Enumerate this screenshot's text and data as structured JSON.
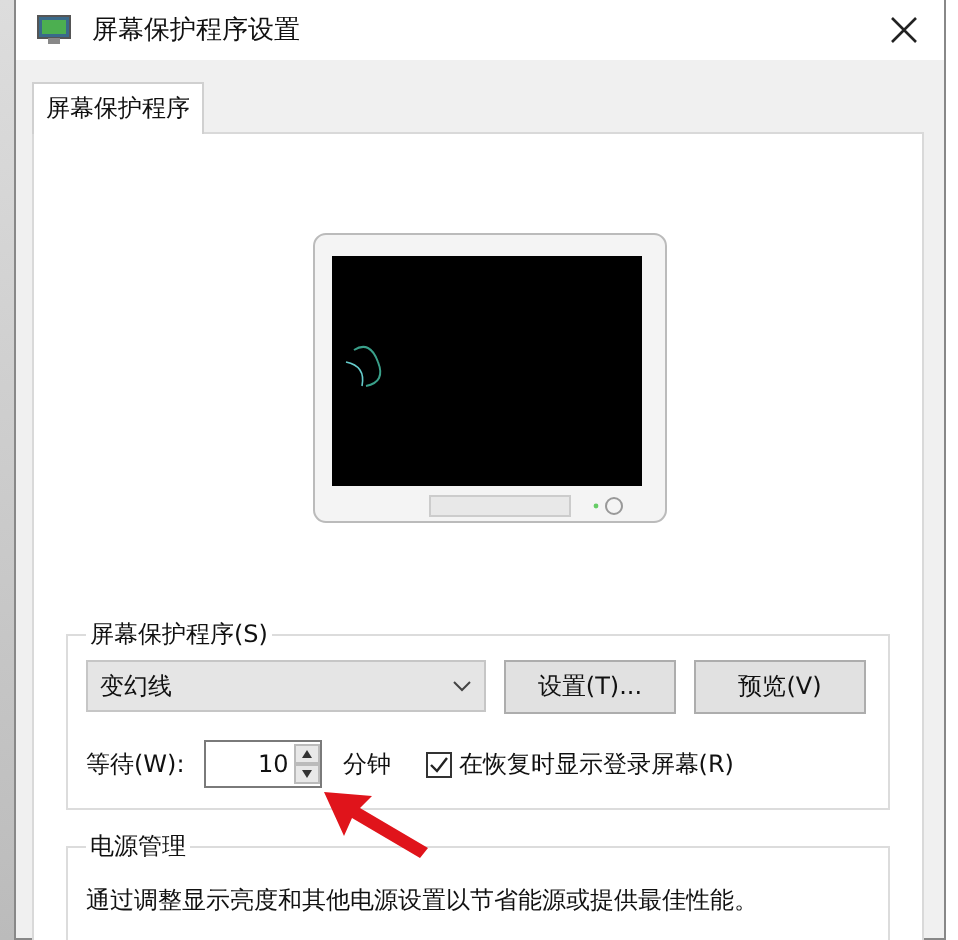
{
  "window": {
    "title": "屏幕保护程序设置"
  },
  "tabs": [
    {
      "label": "屏幕保护程序",
      "selected": true
    }
  ],
  "screensaver_group": {
    "title": "屏幕保护程序(S)",
    "dropdown": {
      "value": "变幻线"
    },
    "buttons": [
      "设置(T)...",
      "预览(V)"
    ],
    "wait_label": "等待(W):",
    "wait_value": "10",
    "wait_unit": "分钟",
    "resume_checkbox": {
      "label": "在恢复时显示登录屏幕(R)",
      "checked": true
    }
  },
  "power_group": {
    "title": "电源管理",
    "text": "通过调整显示亮度和其他电源设置以节省能源或提供最佳性能。"
  }
}
